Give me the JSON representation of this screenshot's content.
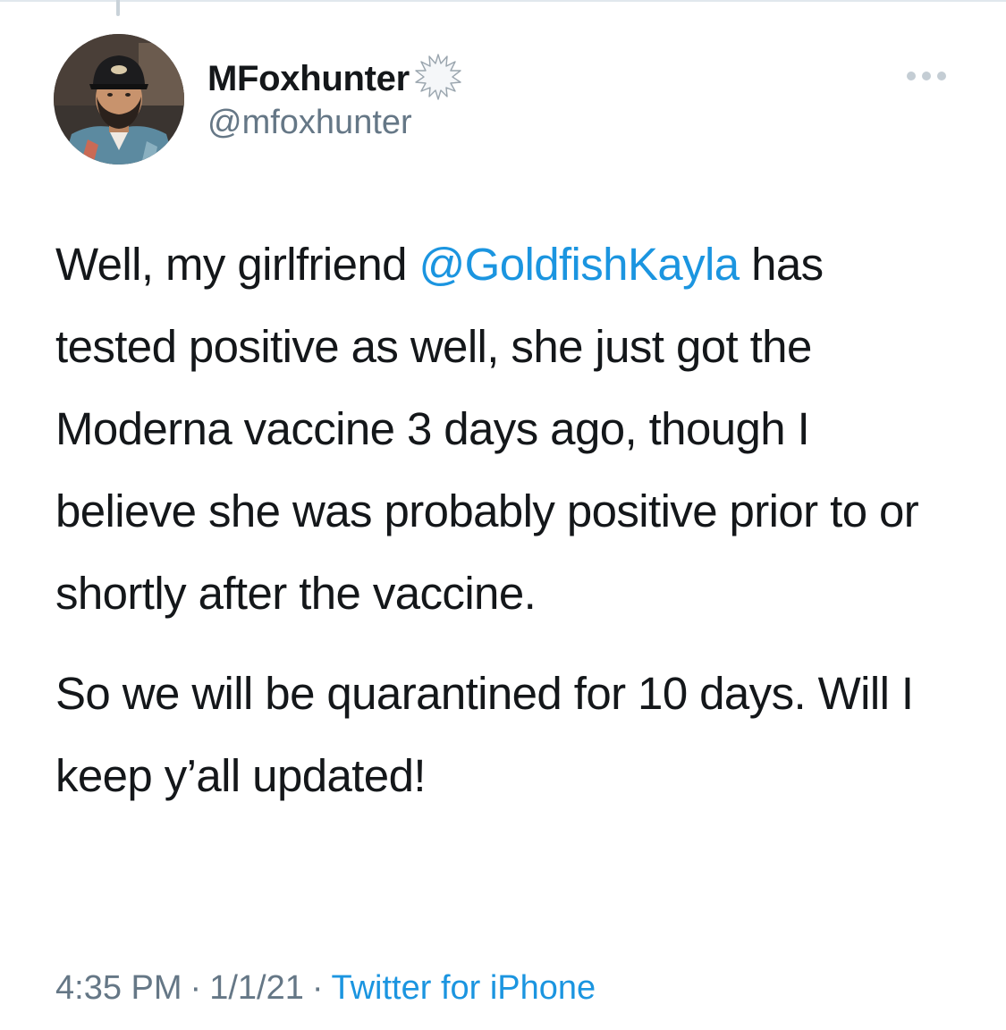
{
  "tweet": {
    "author": {
      "display_name": "MFoxhunter",
      "handle": "@mfoxhunter",
      "avatar": "avatar",
      "badge": "verified-badge-icon"
    },
    "more_icon": "more-options-icon",
    "body": {
      "p1_part1": "Well, my girlfriend ",
      "p1_mention": "@GoldfishKayla",
      "p1_part2": " has tested positive as well, she just got the Moderna vaccine 3 days ago, though I believe she was probably positive prior to or shortly after the vaccine.",
      "p2": "So we will be quarantined for 10 days. Will I keep y’all updated!"
    },
    "meta": {
      "time": "4:35 PM",
      "separator": "·",
      "date": "1/1/21",
      "source": "Twitter for iPhone"
    }
  },
  "colors": {
    "text": "#14171a",
    "secondary": "#657786",
    "link": "#1b95e0",
    "background": "#ffffff"
  }
}
